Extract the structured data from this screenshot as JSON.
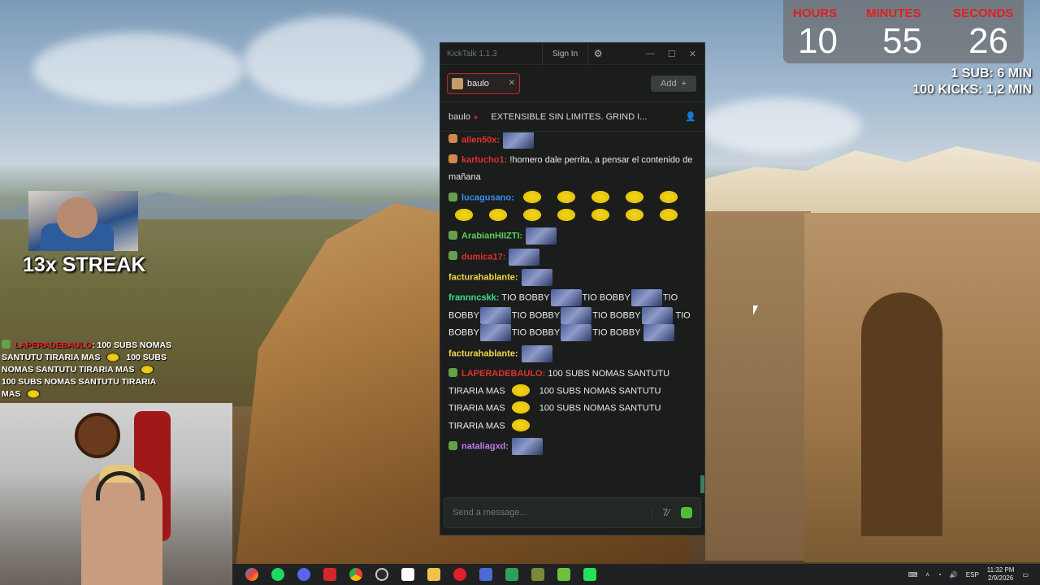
{
  "timer": {
    "hours_label": "HOURS",
    "minutes_label": "MINUTES",
    "seconds_label": "SECONDS",
    "hours": "10",
    "minutes": "55",
    "seconds": "26",
    "sub_rate": "1 SUB: 6 MIN",
    "kick_rate": "100 KICKS: 1,2 MIN"
  },
  "streak": {
    "text": "13x STREAK"
  },
  "overlay_chat": {
    "username": "LAPERADEBAULO",
    "message_a": ": 100 SUBS NOMAS SANTUTU TIRARIA MAS ",
    "message_b": " 100 SUBS NOMAS SANTUTU TIRARIA MAS ",
    "message_c": " 100 SUBS NOMAS SANTUTU TIRARIA MAS "
  },
  "kicktalk": {
    "app_name": "KickTalk 1.1.3",
    "sign_in": "Sign In",
    "tab_label": "baulo",
    "add_label": "Add",
    "channel": "baulo",
    "stream_title": "EXTENSIBLE SIN LIMITES. GRIND I...",
    "input_placeholder": "Send a message...",
    "messages": [
      {
        "user": "allen50x:",
        "color": "#e0302f",
        "text": ""
      },
      {
        "user": "kartucho1:",
        "color": "#e0302f",
        "text": "!homero dale perrita, a pensar el contenido de mañana"
      },
      {
        "user": "lucagusano:",
        "color": "#3b8cf2",
        "text": ""
      },
      {
        "user": "ArabianHIIZTI:",
        "color": "#5fcf5a",
        "text": ""
      },
      {
        "user": "dumica17:",
        "color": "#e0302f",
        "text": ""
      },
      {
        "user": "facturahablante:",
        "color": "#f1d64b",
        "text": ""
      },
      {
        "user": "frannncskk:",
        "color": "#3de08a",
        "tio": "TIO BOBBY",
        "tio_a": "TIO",
        "tio_b": "BOBBY"
      },
      {
        "user": "facturahablante:",
        "color": "#f1d64b",
        "text": ""
      },
      {
        "user": "LAPERADEBAULO:",
        "color": "#e0302f",
        "text": "100 SUBS NOMAS SANTUTU",
        "text2": "TIRARIA MAS",
        "text3": "100 SUBS NOMAS SANTUTU"
      },
      {
        "user": "nataliagxd:",
        "color": "#c07de8",
        "text": ""
      }
    ]
  },
  "taskbar": {
    "language": "ESP",
    "time": "11:32 PM",
    "date": "2/9/2026"
  }
}
